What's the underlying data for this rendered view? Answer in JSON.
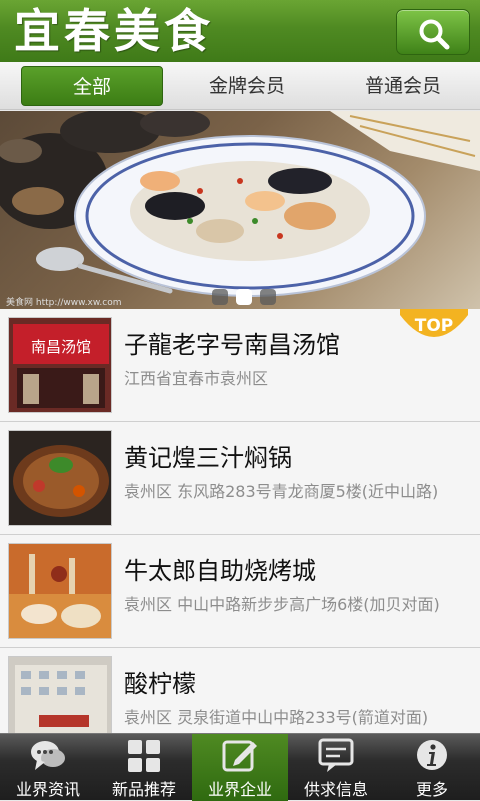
{
  "header": {
    "title": "宜春美食",
    "search_icon": "search-icon",
    "accent_color": "#4f8a22"
  },
  "tabs": [
    {
      "label": "全部",
      "active": true
    },
    {
      "label": "金牌会员",
      "active": false
    },
    {
      "label": "普通会员",
      "active": false
    }
  ],
  "banner": {
    "watermark": "美食网 http://www.xw.com",
    "pager": {
      "count": 3,
      "active_index": 1
    }
  },
  "badge": {
    "label": "TOP",
    "color": "#f3b321"
  },
  "restaurants": [
    {
      "name": "子龍老字号南昌汤馆",
      "address": "江西省宜春市袁州区",
      "sign": "南昌汤馆",
      "top": true
    },
    {
      "name": "黄记煌三汁焖锅",
      "address": "袁州区 东风路283号青龙商厦5楼(近中山路)",
      "top": false
    },
    {
      "name": "牛太郎自助烧烤城",
      "address": "袁州区 中山中路新步步高广场6楼(加贝对面)",
      "top": false
    },
    {
      "name": "酸柠檬",
      "address": "袁州区 灵泉街道中山中路233号(箭道对面)",
      "top": false
    }
  ],
  "bottom_nav": [
    {
      "label": "业界资讯",
      "icon": "chat-bubbles-icon",
      "active": false
    },
    {
      "label": "新品推荐",
      "icon": "grid-icon",
      "active": false
    },
    {
      "label": "业界企业",
      "icon": "edit-icon",
      "active": true
    },
    {
      "label": "供求信息",
      "icon": "message-icon",
      "active": false
    },
    {
      "label": "更多",
      "icon": "info-icon",
      "active": false
    }
  ]
}
